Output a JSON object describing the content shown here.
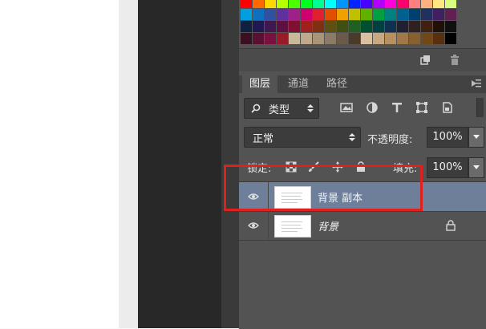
{
  "tabs": [
    {
      "label": "图层",
      "active": true
    },
    {
      "label": "通道",
      "active": false
    },
    {
      "label": "路径",
      "active": false
    }
  ],
  "filter": {
    "label": "类型"
  },
  "blend": {
    "mode": "正常"
  },
  "opacity": {
    "label": "不透明度:",
    "value": "100%"
  },
  "lock": {
    "label": "锁定:"
  },
  "fill": {
    "label": "填充:",
    "value": "100%"
  },
  "layers": [
    {
      "name": "背景 副本",
      "selected": true,
      "visible": true,
      "locked": false,
      "italic": false
    },
    {
      "name": "背景",
      "selected": false,
      "visible": true,
      "locked": true,
      "italic": true
    }
  ],
  "colors": {
    "accent_selection": "#6e7f99",
    "annotation": "#e01f1f",
    "panel": "#535353"
  }
}
